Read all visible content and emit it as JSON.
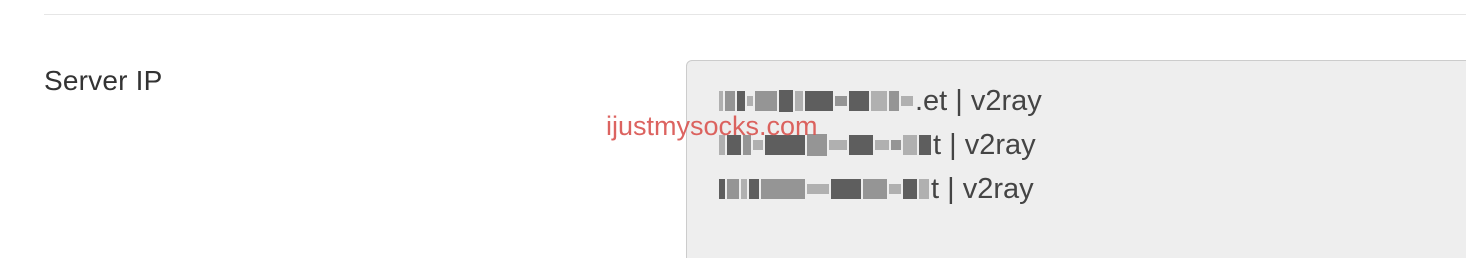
{
  "field": {
    "label": "Server IP"
  },
  "servers": [
    {
      "suffix": ".et | v2ray"
    },
    {
      "suffix": "t | v2ray"
    },
    {
      "suffix": "t | v2ray"
    }
  ],
  "watermark": {
    "text": "ijustmysocks.com"
  },
  "colors": {
    "box_background": "#eeeeee",
    "box_border": "#cccccc",
    "watermark": "#d9534f",
    "label_text": "#333333"
  }
}
